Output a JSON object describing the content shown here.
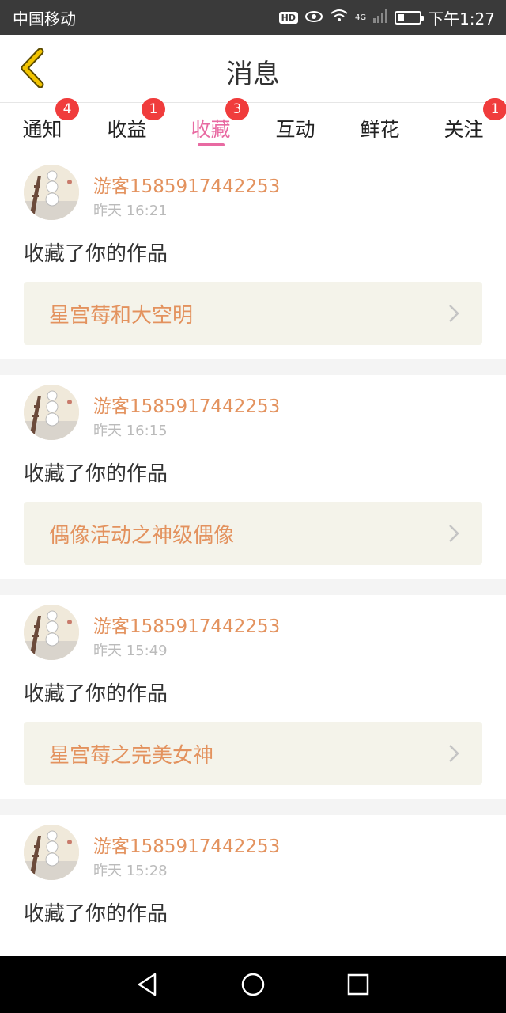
{
  "status_bar": {
    "carrier": "中国移动",
    "hd_label": "HD",
    "network": "4G",
    "time": "下午1:27",
    "battery_level": 0.3
  },
  "header": {
    "title": "消息",
    "back_icon": "chevron-left-icon"
  },
  "tabs": [
    {
      "label": "通知",
      "badge": "4"
    },
    {
      "label": "收益",
      "badge": "1"
    },
    {
      "label": "收藏",
      "badge": "3",
      "active": true
    },
    {
      "label": "互动",
      "badge": ""
    },
    {
      "label": "鲜花",
      "badge": ""
    },
    {
      "label": "关注",
      "badge": "1"
    }
  ],
  "messages": [
    {
      "user": "游客1585917442253",
      "time": "昨天 16:21",
      "action": "收藏了你的作品",
      "work": "星宫莓和大空明"
    },
    {
      "user": "游客1585917442253",
      "time": "昨天 16:15",
      "action": "收藏了你的作品",
      "work": "偶像活动之神级偶像"
    },
    {
      "user": "游客1585917442253",
      "time": "昨天 15:49",
      "action": "收藏了你的作品",
      "work": "星宫莓之完美女神"
    },
    {
      "user": "游客1585917442253",
      "time": "昨天 15:28",
      "action": "收藏了你的作品",
      "work": ""
    }
  ],
  "colors": {
    "accent": "#e86aa2",
    "username": "#e3925e",
    "badge": "#f03c3c",
    "back_icon": "#e8b800"
  }
}
